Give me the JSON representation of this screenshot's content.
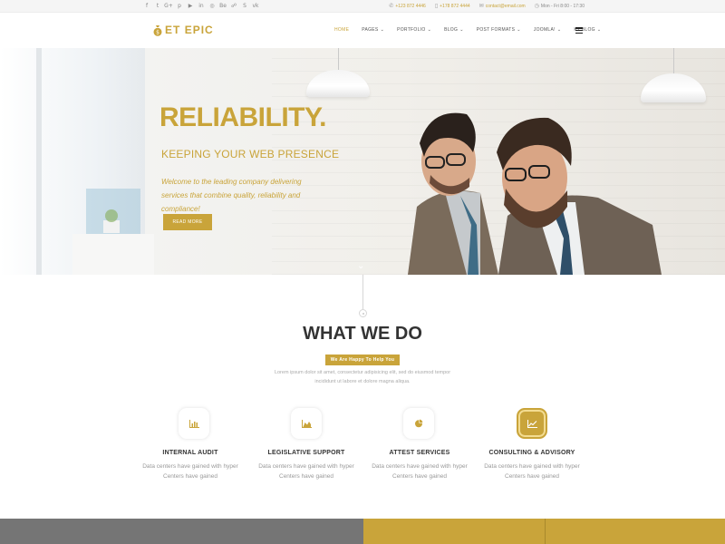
{
  "topbar": {
    "social_icons": [
      "facebook-icon",
      "twitter-icon",
      "google-plus-icon",
      "pinterest-icon",
      "youtube-icon",
      "linkedin-icon",
      "dribbble-icon",
      "behance-icon",
      "flickr-icon",
      "skype-icon",
      "vk-icon"
    ],
    "social_glyphs": [
      "f",
      "t",
      "G+",
      "p",
      "▶",
      "in",
      "◎",
      "Be",
      "☍",
      "S",
      "vk"
    ],
    "phone1": "+123 872 4446",
    "phone2": "+178 872 4444",
    "email": "contact@email.com",
    "hours": "Mon - Fri 8:00 - 17:30"
  },
  "header": {
    "logo_et": "ET",
    "logo_name": "EPIC",
    "nav": [
      {
        "label": "Home",
        "dropdown": false,
        "active": true
      },
      {
        "label": "Pages",
        "dropdown": true
      },
      {
        "label": "Portfolio",
        "dropdown": true
      },
      {
        "label": "Blog",
        "dropdown": true
      },
      {
        "label": "Post Formats",
        "dropdown": true
      },
      {
        "label": "Joomla!",
        "dropdown": true
      },
      {
        "label": "K2 Blog",
        "dropdown": true
      }
    ]
  },
  "hero": {
    "title": "RELIABILITY.",
    "subtitle": "KEEPING YOUR WEB PRESENCE",
    "text": "Welcome to the leading company delivering services that combine quality, reliability and compliance!",
    "button": "Read More"
  },
  "what_we_do": {
    "title": "WHAT WE DO",
    "badge": "We Are Happy To Help You",
    "description": "Lorem ipsum dolor sit amet, consectetur adipisicing elit, sed do eiusmod tempor incididunt ut labore et dolore magna aliqua.",
    "services": [
      {
        "title": "INTERNAL AUDIT",
        "desc": "Data centers have gained with hyper Centers have gained",
        "icon": "bar-chart-icon",
        "active": false
      },
      {
        "title": "LEGISLATIVE SUPPORT",
        "desc": "Data centers have gained with hyper Centers have gained",
        "icon": "area-chart-icon",
        "active": false
      },
      {
        "title": "ATTEST SERVICES",
        "desc": "Data centers have gained with hyper Centers have gained",
        "icon": "pie-chart-icon",
        "active": false
      },
      {
        "title": "CONSULTING & ADVISORY",
        "desc": "Data centers have gained with hyper Centers have gained",
        "icon": "line-chart-icon",
        "active": true
      }
    ]
  },
  "colors": {
    "accent": "#c9a43a",
    "strip_grey": "#757575"
  }
}
